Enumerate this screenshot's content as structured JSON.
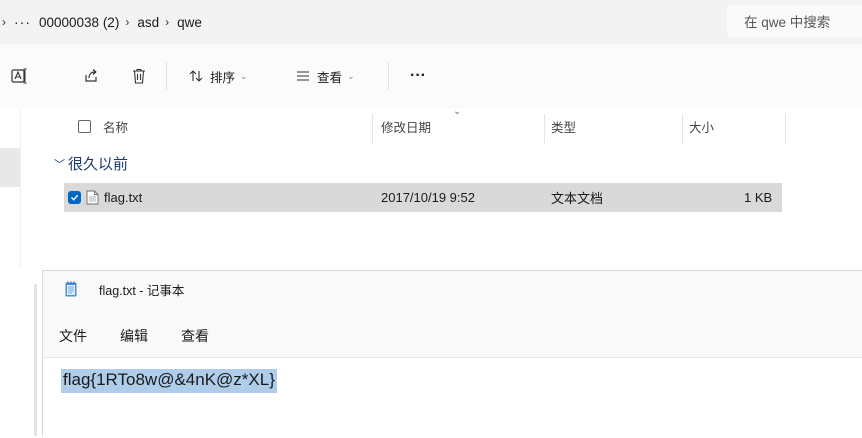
{
  "address_bar": {
    "more": "···",
    "breadcrumbs": [
      "00000038 (2)",
      "asd",
      "qwe"
    ],
    "search_placeholder": "在 qwe 中搜索"
  },
  "toolbar": {
    "sort_label": "排序",
    "view_label": "查看",
    "more_label": "···"
  },
  "columns": {
    "name": "名称",
    "modified": "修改日期",
    "type": "类型",
    "size": "大小"
  },
  "group": {
    "label": "很久以前"
  },
  "files": [
    {
      "name": "flag.txt",
      "modified": "2017/10/19 9:52",
      "type": "文本文档",
      "size": "1 KB",
      "selected": true
    }
  ],
  "notepad": {
    "title": "flag.txt - 记事本",
    "menu": {
      "file": "文件",
      "edit": "编辑",
      "view": "查看"
    },
    "content": "flag{1RTo8w@&4nK@z*XL}"
  },
  "colors": {
    "accent": "#0067c0",
    "selection_row": "#d9d9d9",
    "text_selection": "#aecdea",
    "group_header": "#1b3b6f"
  }
}
